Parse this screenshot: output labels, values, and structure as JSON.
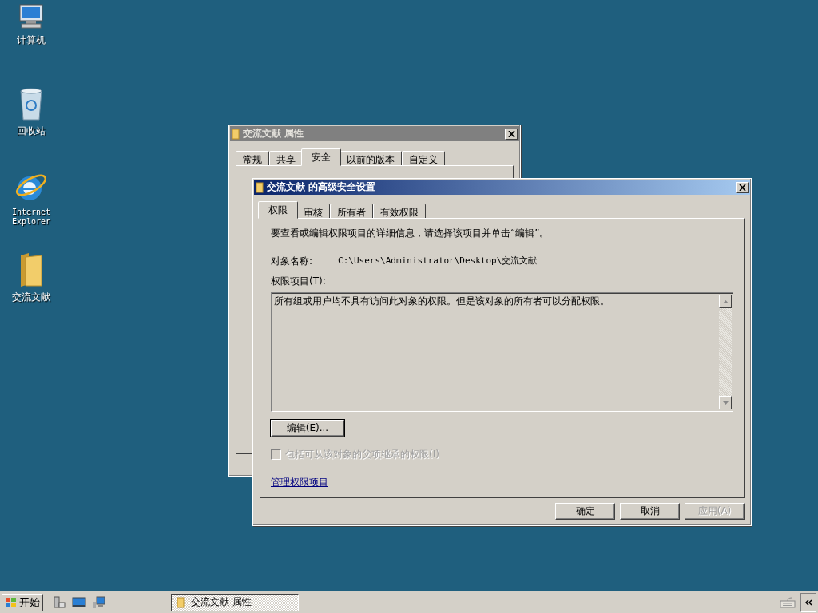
{
  "desktop_icons": [
    {
      "label": "计算机",
      "kind": "computer"
    },
    {
      "label": "回收站",
      "kind": "recycle"
    },
    {
      "label": "Internet Explorer",
      "kind": "ie"
    },
    {
      "label": "交流文献",
      "kind": "folder"
    }
  ],
  "back_window": {
    "title": "交流文献 属性",
    "tabs": [
      {
        "label": "常规",
        "selected": false
      },
      {
        "label": "共享",
        "selected": false
      },
      {
        "label": "安全",
        "selected": true
      },
      {
        "label": "以前的版本",
        "selected": false
      },
      {
        "label": "自定义",
        "selected": false
      }
    ]
  },
  "dialog": {
    "title": "交流文献 的高级安全设置",
    "tabs": [
      {
        "label": "权限",
        "selected": true
      },
      {
        "label": "审核",
        "selected": false
      },
      {
        "label": "所有者",
        "selected": false
      },
      {
        "label": "有效权限",
        "selected": false
      }
    ],
    "instruction": "要查看或编辑权限项目的详细信息，请选择该项目并单击“编辑”。",
    "object_name_label": "对象名称:",
    "object_name_value": "C:\\Users\\Administrator\\Desktop\\交流文献",
    "entries_label": "权限项目(T):",
    "entries_text": "所有组或用户均不具有访问此对象的权限。但是该对象的所有者可以分配权限。",
    "edit_button": "编辑(E)...",
    "inherit_checkbox": {
      "label": "包括可从该对象的父项继承的权限(I)",
      "checked": false,
      "disabled": true
    },
    "manage_link": "管理权限项目",
    "buttons": [
      {
        "label": "确定",
        "disabled": false
      },
      {
        "label": "取消",
        "disabled": false
      },
      {
        "label": "应用(A)",
        "disabled": true
      }
    ]
  },
  "taskbar": {
    "start_label": "开始",
    "quick_launch": [
      {
        "kind": "server"
      },
      {
        "kind": "desktop"
      },
      {
        "kind": "network"
      }
    ],
    "task": {
      "label": "交流文献 属性",
      "active": true
    }
  }
}
